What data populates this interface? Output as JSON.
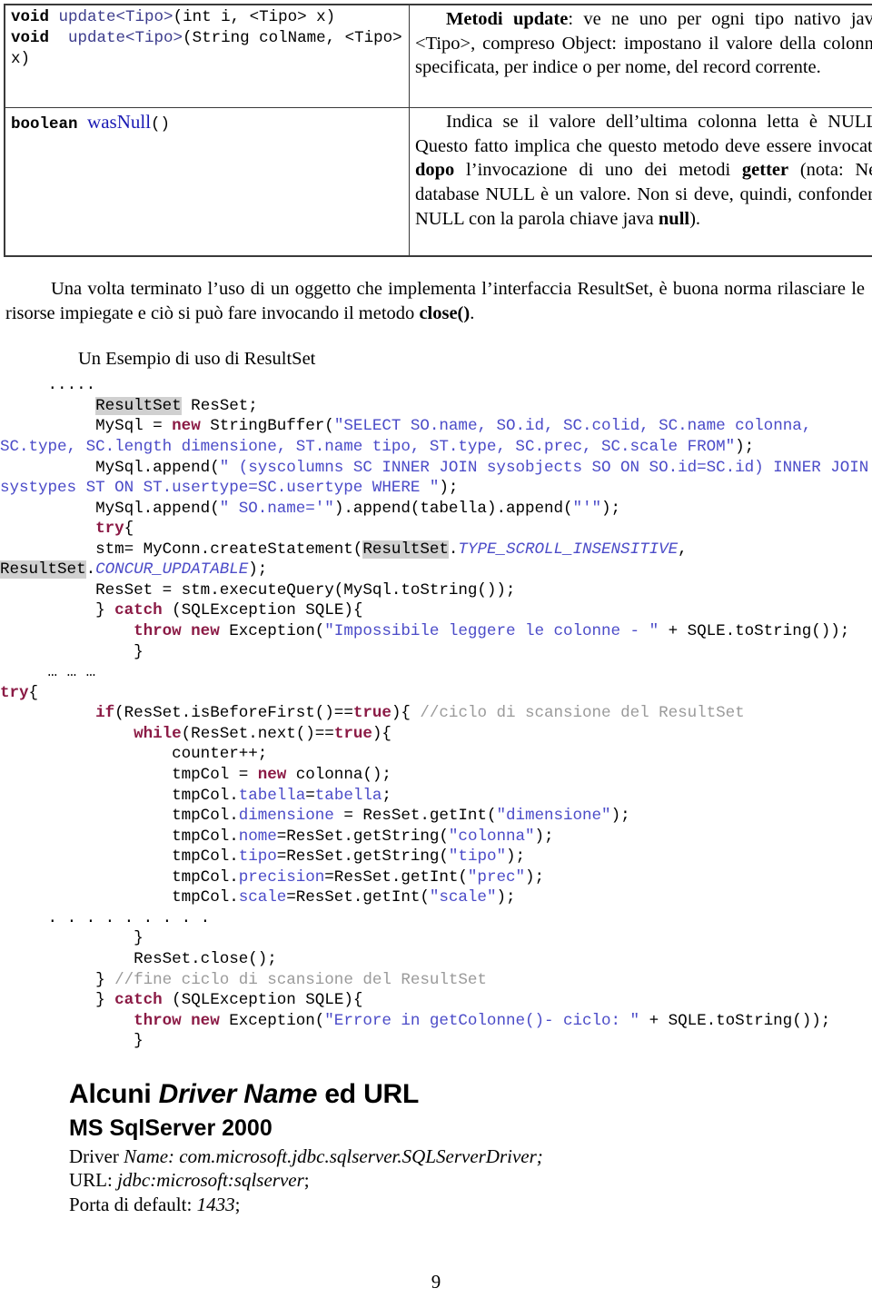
{
  "document": {
    "page_number": "9",
    "language": "it"
  },
  "api_table": {
    "rows": [
      {
        "signature": {
          "line1": {
            "return_type": "void",
            "method": "update<Tipo>",
            "params": "(int i, <Tipo> x)"
          },
          "line2": {
            "return_type": "void",
            "method": "update<Tipo>",
            "params": "(String   colName, <Tipo> x)"
          }
        },
        "description_html": "<b>Metodi update</b>: ve ne uno per ogni tipo nativo java &lt;Tipo&gt;, compreso Object: impostano il valore della colonna specificata, per indice o per nome, del record corrente."
      },
      {
        "signature": {
          "line1": {
            "return_type": "boolean",
            "method": "wasNull",
            "params": "()"
          }
        },
        "description_html": "Indica se il valore dell’ultima colonna letta è NULL. Questo fatto implica che questo metodo deve essere invocato <b>dopo</b> l’invocazione di uno dei metodi <b>getter</b> (nota: Nei database NULL è un valore. Non si deve, quindi, confondere NULL con la parola chiave java <b>null</b>)."
      }
    ]
  },
  "body": {
    "paragraph_html": "Una volta terminato l’uso di un oggetto che implementa l’interfaccia ResultSet, è buona norma rilasciare le risorse impiegate e ciò si può fare invocando il metodo <b>close()</b>.",
    "example_heading": "Un Esempio di uso di ResultSet"
  },
  "code_listing": {
    "language": "java",
    "lines": [
      "     .....",
      "          <hl>ResultSet</hl> ResSet;",
      "          MySql = <kw>new</kw> StringBuffer(<str>\"SELECT SO.name, SO.id, SC.colid, SC.name colonna, SC.type, SC.length dimensione, ST.name tipo, ST.type, SC.prec, SC.scale FROM\"</str>);",
      "          MySql.append(<str>\" (syscolumns SC INNER JOIN sysobjects SO ON SO.id=SC.id) INNER JOIN systypes ST ON ST.usertype=SC.usertype WHERE \"</str>);",
      "          MySql.append(<str>\" SO.name='\"</str>).append(tabella).append(<str>\"'\"</str>);",
      "          <kw>try</kw>{",
      "          stm= MyConn.createStatement(<hl>ResultSet</hl>.<it>TYPE_SCROLL_INSENSITIVE</it>, <hl>ResultSet</hl>.<it>CONCUR_UPDATABLE</it>);",
      "          ResSet = stm.executeQuery(MySql.toString());",
      "          } <kw>catch</kw> (SQLException SQLE){",
      "              <kw>throw new</kw> Exception(<str>\"Impossibile leggere le colonne - \"</str> + SQLE.toString());",
      "              }",
      "     … … …",
      "<kw>try</kw>{",
      "          <kw>if</kw>(ResSet.isBeforeFirst()==<kw>true</kw>){ <cmt>//ciclo di scansione del ResultSet</cmt>",
      "              <kw>while</kw>(ResSet.next()==<kw>true</kw>){",
      "                  counter++;",
      "                  tmpCol = <kw>new</kw> colonna();",
      "                  tmpCol.<fld>tabella</fld>=<fld>tabella</fld>;",
      "                  tmpCol.<fld>dimensione</fld> = ResSet.getInt(<str>\"dimensione\"</str>);",
      "                  tmpCol.<fld>nome</fld>=ResSet.getString(<str>\"colonna\"</str>);",
      "                  tmpCol.<fld>tipo</fld>=ResSet.getString(<str>\"tipo\"</str>);",
      "                  tmpCol.<fld>precision</fld>=ResSet.getInt(<str>\"prec\"</str>);",
      "                  tmpCol.<fld>scale</fld>=ResSet.getInt(<str>\"scale\"</str>);",
      "     . . . . . . . . .",
      "              }",
      "              ResSet.close();",
      "          } <cmt>//fine ciclo di scansione del ResultSet</cmt>",
      "          } <kw>catch</kw> (SQLException SQLE){",
      "              <kw>throw new</kw> Exception(<str>\"Errore in getColonne()- ciclo: \"</str> + SQLE.toString());",
      "              }"
    ]
  },
  "drivers": {
    "heading_html": "Alcuni <i>Driver Name</i> ed URL",
    "subheading": "MS SqlServer 2000",
    "entries_html": [
      "Driver <i>Name: com.microsoft.jdbc.sqlserver.SQLServerDriver;</i>",
      "URL: <i>jdbc:microsoft:sqlserver</i>;",
      "Porta di default: <i>1433</i>;"
    ]
  }
}
